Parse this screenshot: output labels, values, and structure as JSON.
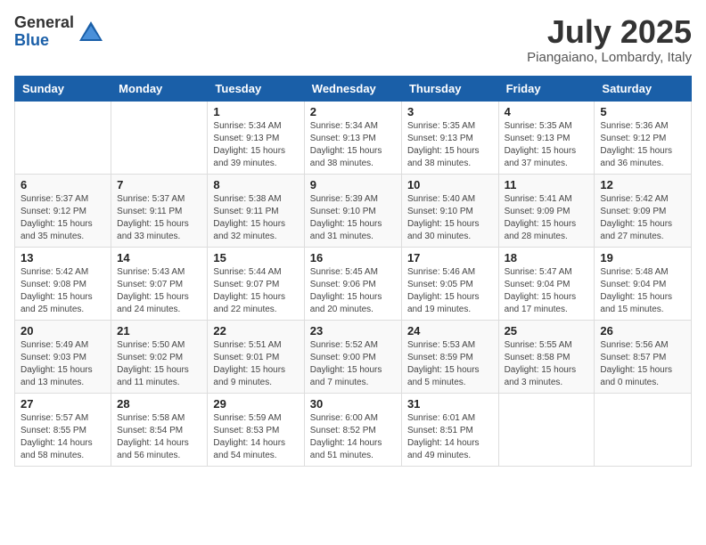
{
  "logo": {
    "general": "General",
    "blue": "Blue"
  },
  "title": {
    "month_year": "July 2025",
    "location": "Piangaiano, Lombardy, Italy"
  },
  "columns": [
    "Sunday",
    "Monday",
    "Tuesday",
    "Wednesday",
    "Thursday",
    "Friday",
    "Saturday"
  ],
  "weeks": [
    [
      {
        "day": "",
        "info": ""
      },
      {
        "day": "",
        "info": ""
      },
      {
        "day": "1",
        "info": "Sunrise: 5:34 AM\nSunset: 9:13 PM\nDaylight: 15 hours and 39 minutes."
      },
      {
        "day": "2",
        "info": "Sunrise: 5:34 AM\nSunset: 9:13 PM\nDaylight: 15 hours and 38 minutes."
      },
      {
        "day": "3",
        "info": "Sunrise: 5:35 AM\nSunset: 9:13 PM\nDaylight: 15 hours and 38 minutes."
      },
      {
        "day": "4",
        "info": "Sunrise: 5:35 AM\nSunset: 9:13 PM\nDaylight: 15 hours and 37 minutes."
      },
      {
        "day": "5",
        "info": "Sunrise: 5:36 AM\nSunset: 9:12 PM\nDaylight: 15 hours and 36 minutes."
      }
    ],
    [
      {
        "day": "6",
        "info": "Sunrise: 5:37 AM\nSunset: 9:12 PM\nDaylight: 15 hours and 35 minutes."
      },
      {
        "day": "7",
        "info": "Sunrise: 5:37 AM\nSunset: 9:11 PM\nDaylight: 15 hours and 33 minutes."
      },
      {
        "day": "8",
        "info": "Sunrise: 5:38 AM\nSunset: 9:11 PM\nDaylight: 15 hours and 32 minutes."
      },
      {
        "day": "9",
        "info": "Sunrise: 5:39 AM\nSunset: 9:10 PM\nDaylight: 15 hours and 31 minutes."
      },
      {
        "day": "10",
        "info": "Sunrise: 5:40 AM\nSunset: 9:10 PM\nDaylight: 15 hours and 30 minutes."
      },
      {
        "day": "11",
        "info": "Sunrise: 5:41 AM\nSunset: 9:09 PM\nDaylight: 15 hours and 28 minutes."
      },
      {
        "day": "12",
        "info": "Sunrise: 5:42 AM\nSunset: 9:09 PM\nDaylight: 15 hours and 27 minutes."
      }
    ],
    [
      {
        "day": "13",
        "info": "Sunrise: 5:42 AM\nSunset: 9:08 PM\nDaylight: 15 hours and 25 minutes."
      },
      {
        "day": "14",
        "info": "Sunrise: 5:43 AM\nSunset: 9:07 PM\nDaylight: 15 hours and 24 minutes."
      },
      {
        "day": "15",
        "info": "Sunrise: 5:44 AM\nSunset: 9:07 PM\nDaylight: 15 hours and 22 minutes."
      },
      {
        "day": "16",
        "info": "Sunrise: 5:45 AM\nSunset: 9:06 PM\nDaylight: 15 hours and 20 minutes."
      },
      {
        "day": "17",
        "info": "Sunrise: 5:46 AM\nSunset: 9:05 PM\nDaylight: 15 hours and 19 minutes."
      },
      {
        "day": "18",
        "info": "Sunrise: 5:47 AM\nSunset: 9:04 PM\nDaylight: 15 hours and 17 minutes."
      },
      {
        "day": "19",
        "info": "Sunrise: 5:48 AM\nSunset: 9:04 PM\nDaylight: 15 hours and 15 minutes."
      }
    ],
    [
      {
        "day": "20",
        "info": "Sunrise: 5:49 AM\nSunset: 9:03 PM\nDaylight: 15 hours and 13 minutes."
      },
      {
        "day": "21",
        "info": "Sunrise: 5:50 AM\nSunset: 9:02 PM\nDaylight: 15 hours and 11 minutes."
      },
      {
        "day": "22",
        "info": "Sunrise: 5:51 AM\nSunset: 9:01 PM\nDaylight: 15 hours and 9 minutes."
      },
      {
        "day": "23",
        "info": "Sunrise: 5:52 AM\nSunset: 9:00 PM\nDaylight: 15 hours and 7 minutes."
      },
      {
        "day": "24",
        "info": "Sunrise: 5:53 AM\nSunset: 8:59 PM\nDaylight: 15 hours and 5 minutes."
      },
      {
        "day": "25",
        "info": "Sunrise: 5:55 AM\nSunset: 8:58 PM\nDaylight: 15 hours and 3 minutes."
      },
      {
        "day": "26",
        "info": "Sunrise: 5:56 AM\nSunset: 8:57 PM\nDaylight: 15 hours and 0 minutes."
      }
    ],
    [
      {
        "day": "27",
        "info": "Sunrise: 5:57 AM\nSunset: 8:55 PM\nDaylight: 14 hours and 58 minutes."
      },
      {
        "day": "28",
        "info": "Sunrise: 5:58 AM\nSunset: 8:54 PM\nDaylight: 14 hours and 56 minutes."
      },
      {
        "day": "29",
        "info": "Sunrise: 5:59 AM\nSunset: 8:53 PM\nDaylight: 14 hours and 54 minutes."
      },
      {
        "day": "30",
        "info": "Sunrise: 6:00 AM\nSunset: 8:52 PM\nDaylight: 14 hours and 51 minutes."
      },
      {
        "day": "31",
        "info": "Sunrise: 6:01 AM\nSunset: 8:51 PM\nDaylight: 14 hours and 49 minutes."
      },
      {
        "day": "",
        "info": ""
      },
      {
        "day": "",
        "info": ""
      }
    ]
  ]
}
